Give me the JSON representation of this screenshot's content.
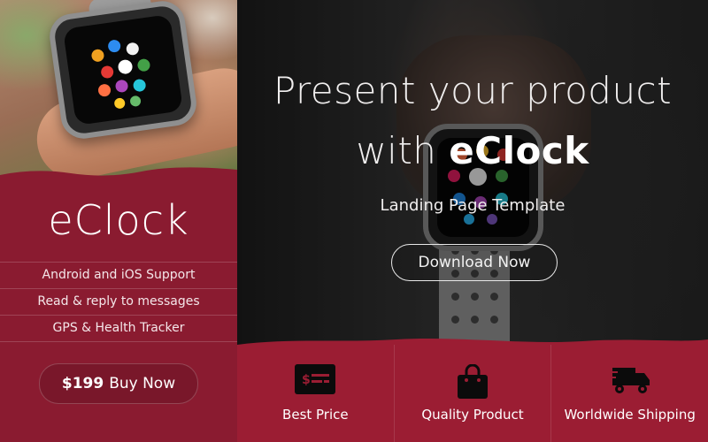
{
  "brand": {
    "name": "eClock",
    "accent": "#9b1d33"
  },
  "sidebar": {
    "title": "eClock",
    "features": [
      "Android and iOS Support",
      "Read & reply to messages",
      "GPS & Health Tracker"
    ],
    "buy": {
      "price": "$199",
      "label": "Buy Now"
    }
  },
  "hero": {
    "title_line1": "Present your product",
    "title_line2_prefix": "with ",
    "title_line2_brand": "eClock",
    "subtitle": "Landing Page Template",
    "download_label": "Download Now"
  },
  "benefits": [
    {
      "icon": "credit-card-icon",
      "label": "Best Price"
    },
    {
      "icon": "shopping-bag-icon",
      "label": "Quality Product"
    },
    {
      "icon": "shipping-truck-icon",
      "label": "Worldwide Shipping"
    }
  ]
}
